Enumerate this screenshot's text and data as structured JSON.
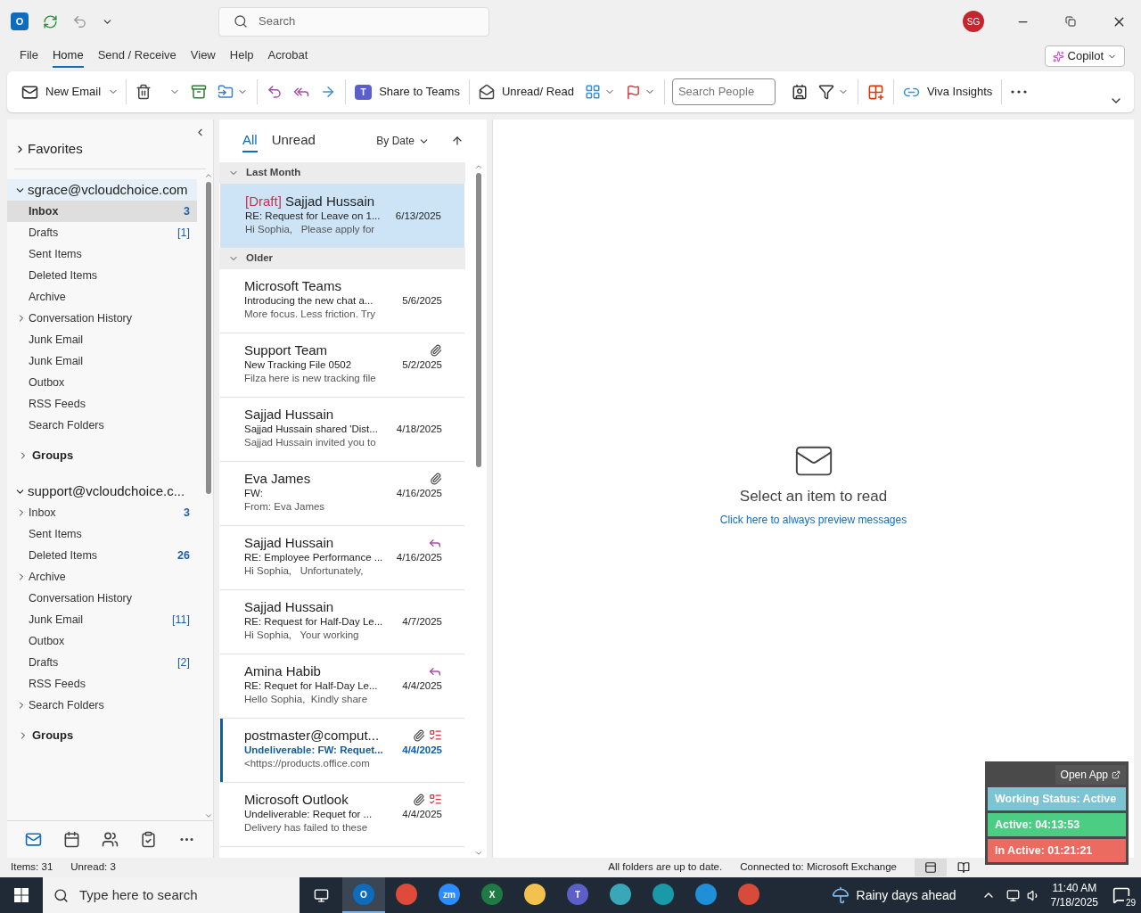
{
  "title_bar": {
    "app_glyph": "O",
    "search": {
      "placeholder": "Search"
    },
    "avatar": "SG"
  },
  "menu_tabs": [
    {
      "label": "File",
      "selected": false
    },
    {
      "label": "Home",
      "selected": true
    },
    {
      "label": "Send / Receive",
      "selected": false
    },
    {
      "label": "View",
      "selected": false
    },
    {
      "label": "Help",
      "selected": false
    },
    {
      "label": "Acrobat",
      "selected": false
    }
  ],
  "copilot": "Copilot",
  "ribbon": {
    "new_email": "New Email",
    "share_to_teams": "Share to Teams",
    "teams_glyph": "T",
    "unread_read": "Unread/ Read",
    "search_people": {
      "placeholder": "Search People"
    },
    "viva_insights": "Viva Insights"
  },
  "favorites": {
    "label": "Favorites",
    "expanded": false
  },
  "accounts": [
    {
      "name": "sgrace@vcloudchoice.com",
      "expanded": true,
      "folders": [
        {
          "name": "Inbox",
          "kind": "folder",
          "selected": true,
          "count": "3",
          "count_unread": true
        },
        {
          "name": "Drafts",
          "kind": "folder",
          "selected": false,
          "count": "[1]",
          "count_unread": false
        },
        {
          "name": "Sent Items",
          "kind": "folder",
          "selected": false
        },
        {
          "name": "Deleted Items",
          "kind": "folder",
          "selected": false
        },
        {
          "name": "Archive",
          "kind": "folder",
          "selected": false
        },
        {
          "name": "Conversation History",
          "kind": "parent",
          "selected": false
        },
        {
          "name": "Junk Email",
          "kind": "folder",
          "selected": false
        },
        {
          "name": "Junk Email",
          "kind": "folder",
          "selected": false
        },
        {
          "name": "Outbox",
          "kind": "folder",
          "selected": false
        },
        {
          "name": "RSS Feeds",
          "kind": "folder",
          "selected": false
        },
        {
          "name": "Search Folders",
          "kind": "folder",
          "selected": false
        },
        {
          "name": "Groups",
          "kind": "group",
          "selected": false
        }
      ]
    },
    {
      "name": "support@vcloudchoice.c...",
      "expanded": true,
      "folders": [
        {
          "name": "Inbox",
          "kind": "parent",
          "selected": false,
          "count": "3",
          "count_unread": true
        },
        {
          "name": "Sent Items",
          "kind": "folder",
          "selected": false
        },
        {
          "name": "Deleted Items",
          "kind": "folder",
          "selected": false,
          "count": "26",
          "count_unread": true
        },
        {
          "name": "Archive",
          "kind": "parent",
          "selected": false
        },
        {
          "name": "Conversation History",
          "kind": "folder",
          "selected": false
        },
        {
          "name": "Junk Email",
          "kind": "folder",
          "selected": false,
          "count": "[11]",
          "count_unread": false
        },
        {
          "name": "Outbox",
          "kind": "folder",
          "selected": false
        },
        {
          "name": "Drafts",
          "kind": "folder",
          "selected": false,
          "count": "[2]",
          "count_unread": false
        },
        {
          "name": "RSS Feeds",
          "kind": "folder",
          "selected": false
        },
        {
          "name": "Search Folders",
          "kind": "parent",
          "selected": false
        },
        {
          "name": "Groups",
          "kind": "group",
          "selected": false
        }
      ]
    }
  ],
  "list_tabs": [
    {
      "label": "All",
      "selected": true
    },
    {
      "label": "Unread",
      "selected": false
    }
  ],
  "sort": "By Date",
  "message_groups": [
    {
      "label": "Last Month",
      "expanded": true,
      "messages": [
        {
          "tag": "[Draft]",
          "sender": "Sajjad Hussain",
          "subject": "RE: Request for Leave on 1...",
          "preview": "Hi Sophia,   Please apply for",
          "date": "6/13/2025",
          "selected": true,
          "unread": false,
          "attachment": false,
          "replied": false,
          "undeliverable": false
        }
      ]
    },
    {
      "label": "Older",
      "expanded": true,
      "messages": [
        {
          "sender": "Microsoft Teams",
          "subject": "Introducing the new chat a...",
          "preview": "More focus. Less friction. Try",
          "date": "5/6/2025",
          "selected": false,
          "unread": false,
          "attachment": false,
          "replied": false,
          "undeliverable": false
        },
        {
          "sender": "Support Team",
          "subject": "New Tracking File 0502",
          "preview": "Filza here is new tracking file",
          "date": "5/2/2025",
          "selected": false,
          "unread": false,
          "attachment": true,
          "replied": false,
          "undeliverable": false
        },
        {
          "sender": "Sajjad Hussain",
          "subject": "Sajjad Hussain shared 'Dist...",
          "preview": "Sajjad Hussain invited you to",
          "date": "4/18/2025",
          "selected": false,
          "unread": false,
          "attachment": false,
          "replied": false,
          "undeliverable": false
        },
        {
          "sender": "Eva James",
          "subject": "FW:",
          "preview": "From: Eva James",
          "date": "4/16/2025",
          "selected": false,
          "unread": false,
          "attachment": true,
          "replied": false,
          "undeliverable": false
        },
        {
          "sender": "Sajjad Hussain",
          "subject": "RE: Employee Performance ...",
          "preview": "Hi Sophia,   Unfortunately,",
          "date": "4/16/2025",
          "selected": false,
          "unread": false,
          "attachment": false,
          "replied": true,
          "undeliverable": false
        },
        {
          "sender": "Sajjad Hussain",
          "subject": "RE: Request for Half-Day Le...",
          "preview": "Hi Sophia,   Your working",
          "date": "4/7/2025",
          "selected": false,
          "unread": false,
          "attachment": false,
          "replied": false,
          "undeliverable": false
        },
        {
          "sender": "Amina Habib",
          "subject": "RE: Requet for Half-Day Le...",
          "preview": "Hello Sophia,  Kindly share",
          "date": "4/4/2025",
          "selected": false,
          "unread": false,
          "attachment": false,
          "replied": true,
          "undeliverable": false
        },
        {
          "sender": "postmaster@comput...",
          "subject": "Undeliverable: FW: Requet...",
          "preview": "<https://products.office.com",
          "date": "4/4/2025",
          "selected": false,
          "unread": true,
          "attachment": true,
          "replied": false,
          "undeliverable": true
        },
        {
          "sender": "Microsoft Outlook",
          "subject": "Undeliverable: Requet for ...",
          "preview": "Delivery has failed to these",
          "date": "4/4/2025",
          "selected": false,
          "unread": false,
          "attachment": true,
          "replied": false,
          "undeliverable": true
        }
      ]
    }
  ],
  "reading_pane": {
    "message": "Select an item to read",
    "link": "Click here to always preview messages"
  },
  "status_bar": {
    "items": "Items: 31",
    "unread": "Unread: 3",
    "sync": "All folders are up to date.",
    "connection": "Connected to: Microsoft Exchange"
  },
  "tracker_widget": {
    "open_app": "Open App",
    "rows": [
      {
        "text": "Working Status: Active",
        "color": "#7cc4d2"
      },
      {
        "text": "Active: 04:13:53",
        "color": "#4ccd84"
      },
      {
        "text": "In Active: 01:21:21",
        "color": "#ec6b60"
      }
    ]
  },
  "taskbar": {
    "search": {
      "placeholder": "Type here to search"
    },
    "apps": [
      {
        "glyph": "O",
        "color": "#0f6cbd",
        "selected": true
      },
      {
        "color": "#e04a3a",
        "selected": false
      },
      {
        "glyph": "zm",
        "color": "#2d8cff",
        "selected": false
      },
      {
        "glyph": "X",
        "color": "#1f7a45",
        "selected": false
      },
      {
        "color": "#f2c14e",
        "selected": false
      },
      {
        "glyph": "T",
        "color": "#5b5fc7",
        "selected": false
      },
      {
        "color": "#3aa7b8",
        "selected": false
      },
      {
        "color": "#1a9aa8",
        "selected": false
      },
      {
        "color": "#1f8fd8",
        "selected": false
      },
      {
        "color": "#d84a3a",
        "selected": false
      }
    ],
    "weather": "Rainy days ahead",
    "time": "11:40 AM",
    "date": "7/18/2025",
    "notifications": "29"
  }
}
